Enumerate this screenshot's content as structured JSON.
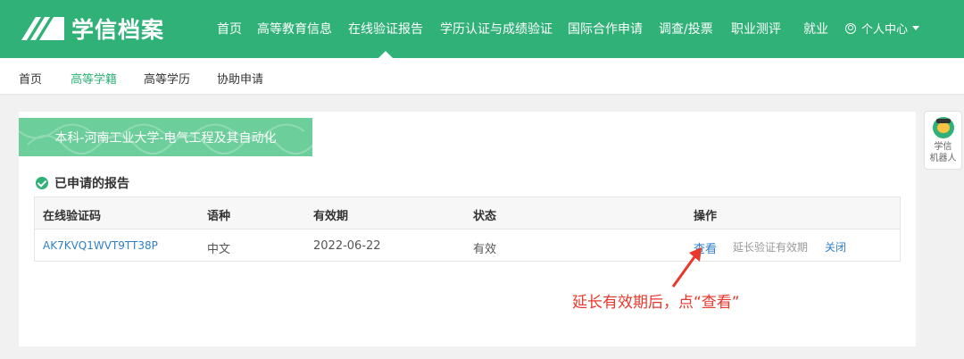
{
  "header": {
    "logo_text": "学信档案",
    "nav": [
      "首页",
      "高等教育信息",
      "在线验证报告",
      "学历认证与成绩验证",
      "国际合作申请",
      "调查/投票",
      "职业测评",
      "就业"
    ],
    "user_menu": "个人中心"
  },
  "subnav": {
    "items": [
      "首页",
      "高等学籍",
      "高等学历",
      "协助申请"
    ],
    "active": "高等学籍"
  },
  "main": {
    "banner": "本科-河南工业大学-电气工程及其自动化",
    "section_title": "已申请的报告",
    "table": {
      "headers": [
        "在线验证码",
        "语种",
        "有效期",
        "状态",
        "操作"
      ],
      "rows": [
        {
          "code": "AK7KVQ1WVT9TT38P",
          "language": "中文",
          "expiry": "2022-06-22",
          "status": "有效",
          "actions": {
            "view": "查看",
            "extend": "延长验证有效期",
            "close": "关闭"
          }
        }
      ]
    }
  },
  "annotation": {
    "text": "延长有效期后，点“查看”",
    "color": "#e8372b"
  },
  "robot": {
    "label_line1": "学信",
    "label_line2": "机器人"
  },
  "colors": {
    "brand": "#2fb177",
    "link": "#2f7fc9",
    "banner": "#6ccf9b"
  }
}
